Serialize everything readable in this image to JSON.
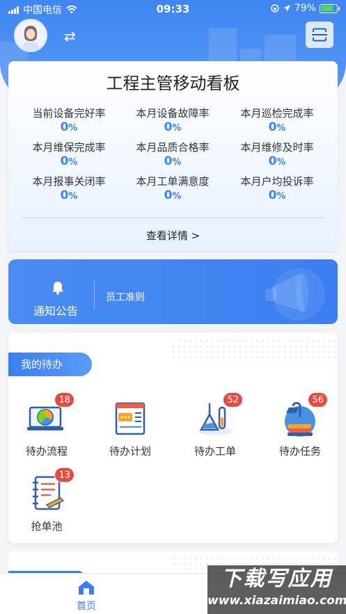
{
  "status_bar": {
    "carrier": "中国电信",
    "time": "09:33",
    "battery": "79%"
  },
  "header": {
    "scan_icon": "scan-icon",
    "switch_icon": "switch-icon"
  },
  "dashboard": {
    "title": "工程主管移动看板",
    "metrics": [
      {
        "label": "当前设备完好率",
        "value": "0",
        "unit": "%"
      },
      {
        "label": "本月设备故障率",
        "value": "0",
        "unit": "%"
      },
      {
        "label": "本月巡检完成率",
        "value": "0",
        "unit": "%"
      },
      {
        "label": "本月维保完成率",
        "value": "0",
        "unit": "%"
      },
      {
        "label": "本月品质合格率",
        "value": "0",
        "unit": "%"
      },
      {
        "label": "本月维修及时率",
        "value": "0",
        "unit": "%"
      },
      {
        "label": "本月报事关闭率",
        "value": "0",
        "unit": "%"
      },
      {
        "label": "本月工单满意度",
        "value": "0",
        "unit": "%"
      },
      {
        "label": "本月户均投诉率",
        "value": "0",
        "unit": "%"
      }
    ],
    "details_link": "查看详情 >"
  },
  "notice": {
    "label": "通知公告",
    "rule": "员工准则"
  },
  "todo": {
    "title": "我的待办",
    "items": [
      {
        "label": "待办流程",
        "badge": "18",
        "icon": "process-icon"
      },
      {
        "label": "待办计划",
        "badge": "",
        "icon": "plan-icon"
      },
      {
        "label": "待办工单",
        "badge": "52",
        "icon": "work-order-icon"
      },
      {
        "label": "待办任务",
        "badge": "56",
        "icon": "task-icon"
      },
      {
        "label": "抢单池",
        "badge": "13",
        "icon": "grab-order-icon"
      }
    ]
  },
  "tabbar": {
    "home": "首页"
  },
  "watermark": {
    "main": "下载写应用",
    "sub": "www.xiazaimiao.com"
  },
  "colors": {
    "primary": "#3a7ff0",
    "badge": "#e84a3f",
    "value": "#3a86f0"
  }
}
